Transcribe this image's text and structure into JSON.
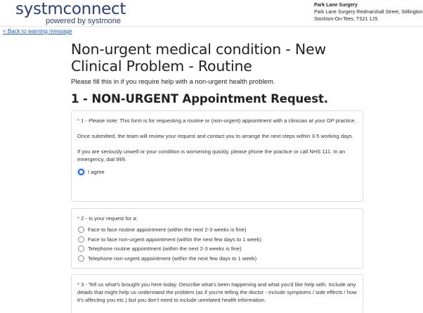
{
  "header": {
    "logo_main": "systmconnect",
    "logo_sub": "powered by systmone",
    "practice_name": "Park Lane Surgery",
    "practice_address_1": "Park Lane Surgery Redmarshall Street, Stillington",
    "practice_address_2": "Stockton-On-Tees, TS21 1JS"
  },
  "nav": {
    "back_link": "< Back to warning message"
  },
  "page": {
    "title": "Non-urgent medical condition - New Clinical Problem - Routine",
    "subtitle": "Please fill this in if you require help with a non-urgent health problem.",
    "section_title": "1 - NON-URGENT Appointment Request."
  },
  "q1": {
    "required_mark": "*",
    "para1": "1 - Please note: This form is for requesting a routine or (non-urgent) appointment with a clinician at your GP practice.",
    "para2": "Once submitted, the team will review your request and contact you to arrange the next steps within 3-5 working days.",
    "para3": "If you are seriously unwell or your condition is worsening quickly, please phone the practice or call NHS 111. In an emergency, dial 999.",
    "agree_label": "I agree",
    "agree_checked": true
  },
  "q2": {
    "required_mark": "*",
    "label": "2 - Is your request for a:",
    "options": [
      "Face to face routine appointment (within the next 2-3 weeks is fine)",
      "Face to face non-urgent appointment (within the next few days to 1 week)",
      "Telephone routine appointment (within the next 2-3 weeks is fine)",
      "Telephone non-urgent appointment (within the next few days to 1 week)"
    ]
  },
  "q3": {
    "required_mark": "*",
    "text": "3 - Tell us what's brought you here today. Describe what's been happening and what you'd like help with. Include any details that might help us understand the problem (as if you're telling the doctor - include symptoms / side effects / how it's affecting you etc.) but you don't need to include unrelated health information."
  },
  "colors": {
    "brand": "#2b3f78",
    "link": "#1a5fd0",
    "required": "#cc2222",
    "radio_selected": "#1a6ee8"
  }
}
